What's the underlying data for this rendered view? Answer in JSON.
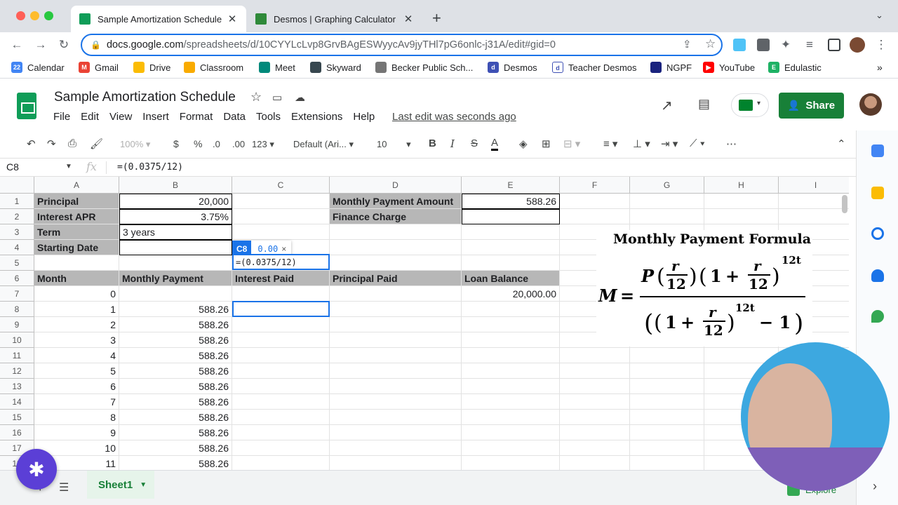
{
  "browser": {
    "tabs": [
      {
        "title": "Sample Amortization Schedule",
        "favicon": "sheets-icon",
        "active": true
      },
      {
        "title": "Desmos | Graphing Calculator",
        "favicon": "desmos-icon",
        "active": false
      }
    ],
    "url_host": "docs.google.com",
    "url_path": "/spreadsheets/d/10CYYLcLvp8GrvBAgESWyycAv9jyTHl7pG6onlc-j31A/edit#gid=0",
    "bookmarks": [
      "Calendar",
      "Gmail",
      "Drive",
      "Classroom",
      "Meet",
      "Skyward",
      "Becker Public Sch...",
      "Desmos",
      "Teacher Desmos",
      "NGPF",
      "YouTube",
      "Edulastic"
    ],
    "bookmarks_more": "»"
  },
  "app": {
    "title": "Sample Amortization Schedule",
    "menu": [
      "File",
      "Edit",
      "View",
      "Insert",
      "Format",
      "Data",
      "Tools",
      "Extensions",
      "Help"
    ],
    "last_edit": "Last edit was seconds ago",
    "share_label": "Share",
    "colors": {
      "accent": "#188038",
      "selection": "#1a73e8",
      "label_bg": "#b7b7b7"
    }
  },
  "format_toolbar": {
    "zoom": "100%",
    "currency": "$",
    "percent": "%",
    "dec_decrease": ".0",
    "dec_increase": ".00",
    "more_formats": "123",
    "font": "Default (Ari...",
    "font_size": "10",
    "bold": "B",
    "italic": "I",
    "strike": "S",
    "text_color": "A"
  },
  "formula_bar": {
    "name_box": "C8",
    "fx": "fx",
    "formula": "=(0.0375/12)"
  },
  "columns": [
    "A",
    "B",
    "C",
    "D",
    "E",
    "F",
    "G",
    "H",
    "I"
  ],
  "rows": [
    "1",
    "2",
    "3",
    "4",
    "5",
    "6",
    "7",
    "8",
    "9",
    "10",
    "11",
    "12",
    "13",
    "14",
    "15",
    "16",
    "17"
  ],
  "cells": {
    "A1": "Principal",
    "B1": "20,000",
    "D1": "Monthly Payment Amount",
    "E1": "588.26",
    "A2": "Interest APR",
    "B2": "3.75%",
    "D2": "Finance Charge",
    "A3": "Term",
    "B3": "3 years",
    "A4": "Starting Date",
    "A6": "Month",
    "B6": "Monthly Payment",
    "C6": "Interest Paid",
    "D6": "Principal Paid",
    "E6": "Loan Balance",
    "A7": "0",
    "E7": "20,000.00",
    "A8": "1",
    "B8": "588.26",
    "A9": "2",
    "B9": "588.26",
    "A10": "3",
    "B10": "588.26",
    "A11": "4",
    "B11": "588.26",
    "A12": "5",
    "B12": "588.26",
    "A13": "6",
    "B13": "588.26",
    "A14": "7",
    "B14": "588.26",
    "A15": "8",
    "B15": "588.26",
    "A16": "9",
    "B16": "588.26",
    "A17": "10",
    "B17": "588.26",
    "A18": "11",
    "B18": "588.26"
  },
  "edit_popup": {
    "cell": "C8",
    "preview": "0.00",
    "close": "×",
    "editing_text": "=(0.0375/12)"
  },
  "formula_image": {
    "title": "Monthly Payment Formula",
    "lhs": "M",
    "P": "P",
    "r": "r",
    "twelve": "12",
    "one": "1",
    "exp": "12t",
    "minus_one": "− 1",
    "equals": "=",
    "plus": "+"
  },
  "sheet_tabs": [
    "Sheet1"
  ],
  "explore_label": "Explore"
}
